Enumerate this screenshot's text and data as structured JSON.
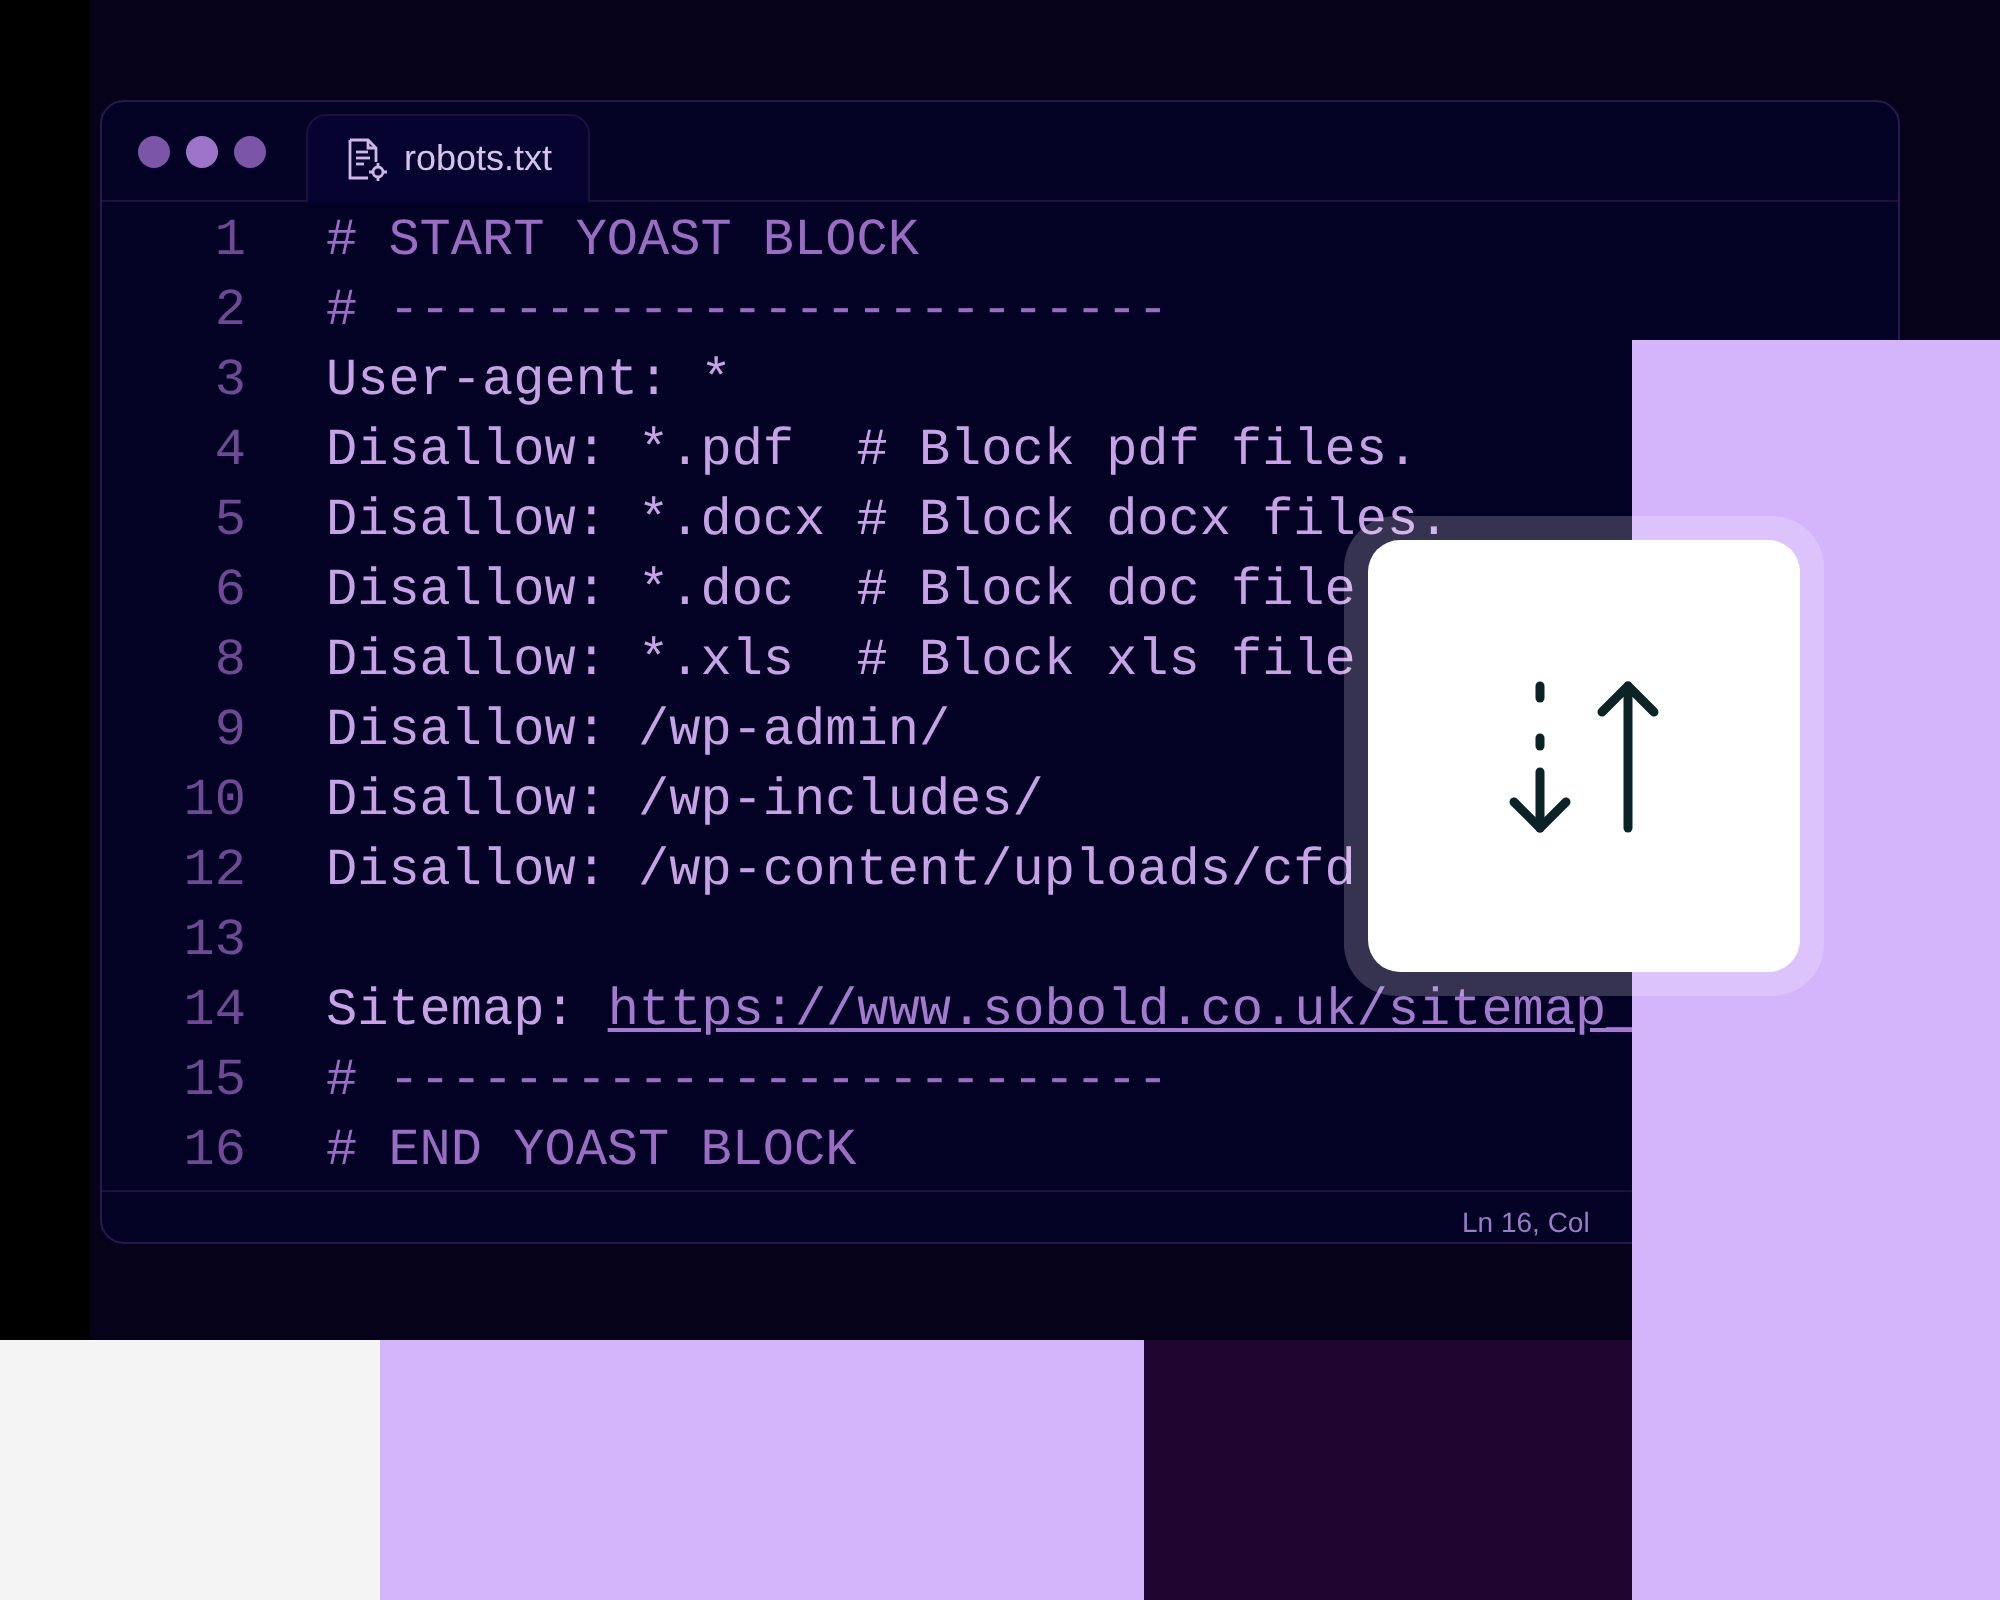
{
  "tabs": [
    {
      "label": "robots.txt",
      "selected": true
    }
  ],
  "lines": [
    {
      "number": "1",
      "kind": "comment",
      "text": "# START YOAST BLOCK"
    },
    {
      "number": "2",
      "kind": "comment",
      "text": "# -------------------------"
    },
    {
      "number": "3",
      "kind": "directive",
      "text": "User-agent: *"
    },
    {
      "number": "4",
      "kind": "directive",
      "text": "Disallow: *.pdf  # Block pdf files."
    },
    {
      "number": "5",
      "kind": "directive",
      "text": "Disallow: *.docx # Block docx files."
    },
    {
      "number": "6",
      "kind": "directive",
      "text": "Disallow: *.doc  # Block doc file"
    },
    {
      "number": "8",
      "kind": "directive",
      "text": "Disallow: *.xls  # Block xls file"
    },
    {
      "number": "9",
      "kind": "directive",
      "text": "Disallow: /wp-admin/"
    },
    {
      "number": "10",
      "kind": "directive",
      "text": "Disallow: /wp-includes/"
    },
    {
      "number": "12",
      "kind": "directive",
      "text": "Disallow: /wp-content/uploads/cfd"
    },
    {
      "number": "13",
      "kind": "blank"
    },
    {
      "number": "14",
      "kind": "link",
      "label": "Sitemap:",
      "url": "https://www.sobold.co.uk/sitemap_"
    },
    {
      "number": "15",
      "kind": "comment",
      "text": "# -------------------------"
    },
    {
      "number": "16",
      "kind": "comment",
      "text": "# END YOAST BLOCK"
    }
  ],
  "status_bar": {
    "position": "Ln 16, Col"
  }
}
